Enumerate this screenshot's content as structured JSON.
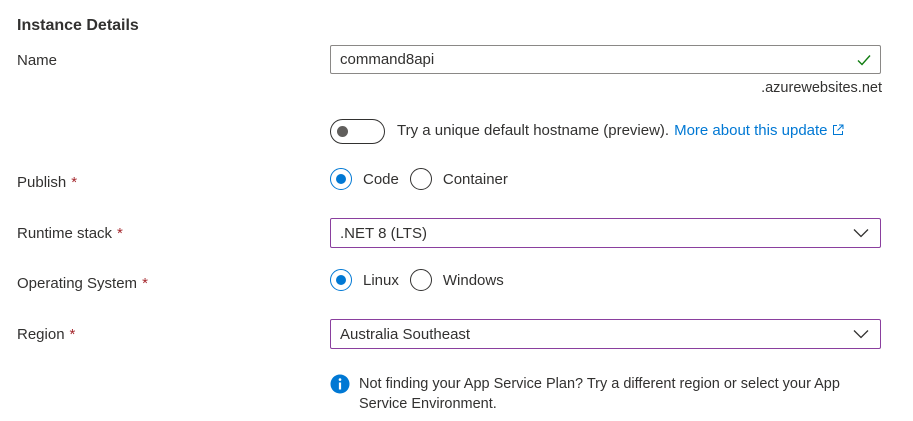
{
  "section_title": "Instance Details",
  "name": {
    "label": "Name",
    "value": "command8api",
    "suffix": ".azurewebsites.net"
  },
  "hostname_toggle": {
    "text": "Try a unique default hostname (preview).",
    "link": "More about this update",
    "on": false
  },
  "publish": {
    "label": "Publish",
    "required_mark": "*",
    "options": [
      "Code",
      "Container"
    ],
    "selected": "Code"
  },
  "runtime_stack": {
    "label": "Runtime stack",
    "required_mark": "*",
    "value": ".NET 8 (LTS)"
  },
  "operating_system": {
    "label": "Operating System",
    "required_mark": "*",
    "options": [
      "Linux",
      "Windows"
    ],
    "selected": "Linux"
  },
  "region": {
    "label": "Region",
    "required_mark": "*",
    "value": "Australia Southeast"
  },
  "info": {
    "text": "Not finding your App Service Plan? Try a different region or select your App Service Environment."
  },
  "colors": {
    "accent": "#0078d4",
    "required": "#a4262c",
    "valid_check": "#107c10",
    "dropdown_border": "#8a3f9e"
  },
  "icons": [
    "check-icon",
    "external-link-icon",
    "chevron-down-icon",
    "info-icon"
  ]
}
